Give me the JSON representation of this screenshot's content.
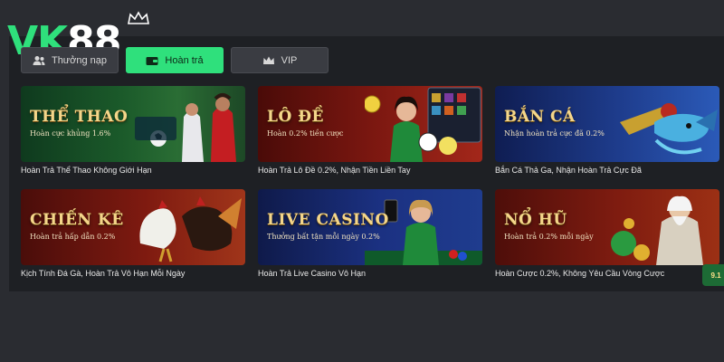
{
  "brand": {
    "logo_text_a": "VK",
    "logo_text_b": "88"
  },
  "tabs": [
    {
      "label": "Thưởng nạp",
      "icon": "users-icon",
      "active": false
    },
    {
      "label": "Hoàn trả",
      "icon": "wallet-icon",
      "active": true
    },
    {
      "label": "VIP",
      "icon": "crown-icon",
      "active": false
    }
  ],
  "cards": [
    {
      "title": "THỂ THAO",
      "subtitle": "Hoàn cực khủng 1.6%",
      "caption": "Hoàn Trả Thể Thao Không Giới Hạn"
    },
    {
      "title": "LÔ ĐỀ",
      "subtitle": "Hoàn 0.2% tiền cược",
      "caption": "Hoàn Trả Lô Đề 0.2%, Nhận Tiền Liền Tay"
    },
    {
      "title": "BẮN CÁ",
      "subtitle": "Nhận hoàn trả cực đã 0.2%",
      "caption": "Bắn Cá Thả Ga, Nhận Hoàn Trả Cực Đã"
    },
    {
      "title": "CHIẾN KÊ",
      "subtitle": "Hoàn trả hấp dẫn 0.2%",
      "caption": "Kịch Tính Đá Gà, Hoàn Trả Vô Hạn Mỗi Ngày"
    },
    {
      "title": "LIVE CASINO",
      "subtitle": "Thưởng bất tận mỗi ngày 0.2%",
      "caption": "Hoàn Trả Live Casino Vô Hạn"
    },
    {
      "title": "NỔ HŨ",
      "subtitle": "Hoàn trả 0.2% mỗi ngày",
      "caption": "Hoàn Cược 0.2%, Không Yêu Cầu Vòng Cược"
    }
  ],
  "sticker": {
    "label": "9.1"
  },
  "colors": {
    "accent": "#2fe07c",
    "background": "#1e2024",
    "title_gold": "#f4d68a"
  }
}
